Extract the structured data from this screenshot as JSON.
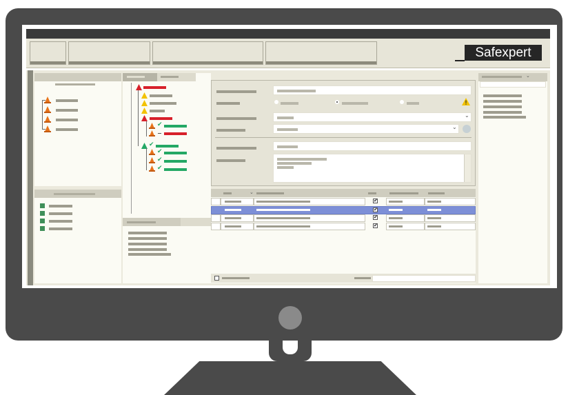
{
  "app": {
    "logo_text": "Safexpert"
  },
  "colors": {
    "bezel": "#4a4a4a",
    "panel_bg": "#fbfbf4",
    "header_bg": "#cfcdbf",
    "toolbar_bg": "#e7e5d8",
    "danger_red": "#d7202a",
    "ok_green": "#24a865",
    "selection_blue": "#7d8fd7",
    "warning_yellow": "#f2c200"
  },
  "icons": {
    "hazard": "warning-triangle-icon",
    "cone": "traffic-cone-icon",
    "check": "check-icon",
    "power": "power-button-icon"
  },
  "form": {
    "dropdown_caret": "⌄"
  },
  "table": {
    "checked_mark": "✔"
  }
}
